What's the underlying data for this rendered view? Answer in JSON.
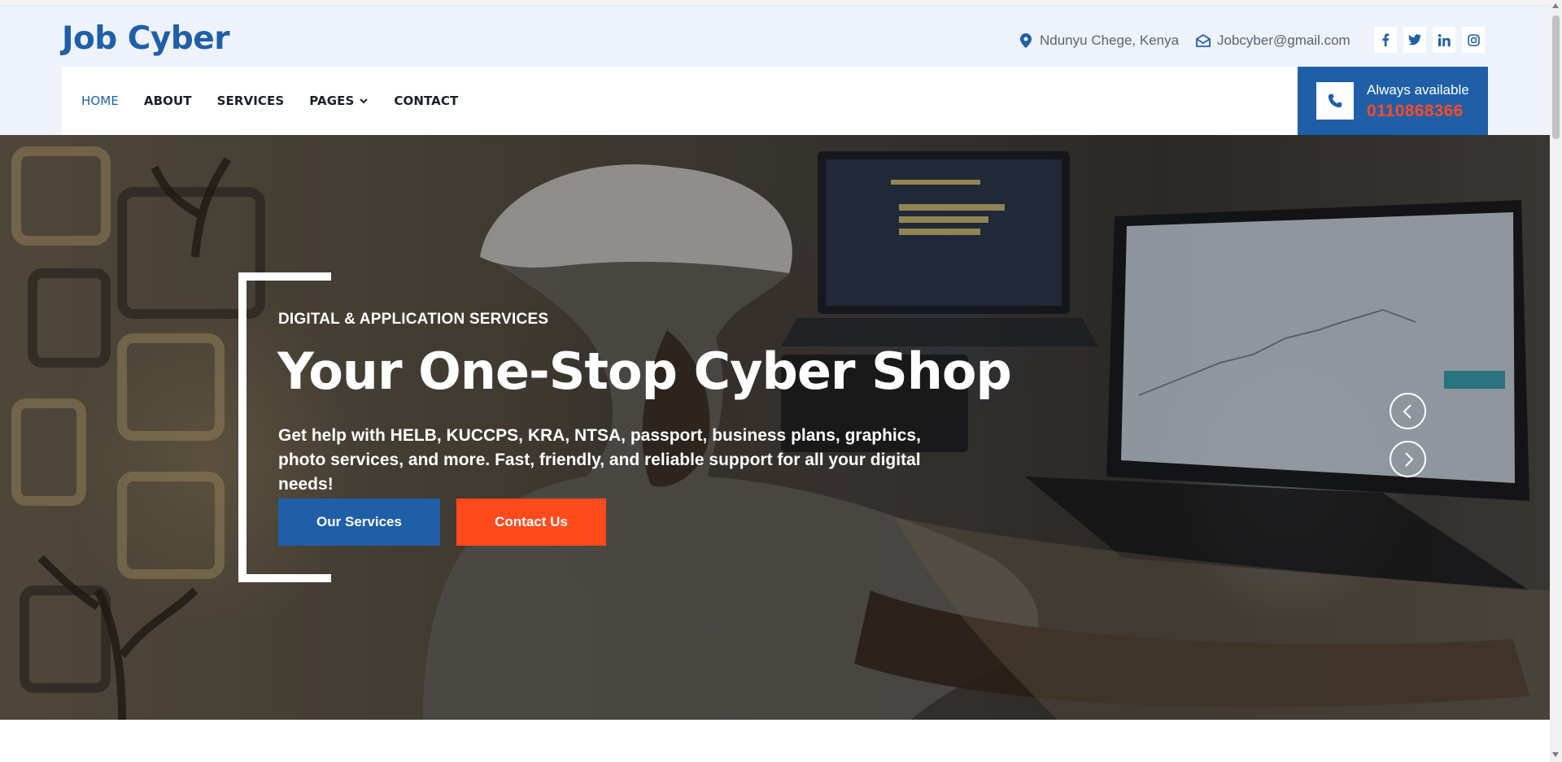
{
  "site": {
    "brand": "Job Cyber"
  },
  "topbar": {
    "location": "Ndunyu Chege, Kenya",
    "email": "Jobcyber@gmail.com",
    "socials": [
      {
        "name": "facebook",
        "glyph": "f"
      },
      {
        "name": "twitter",
        "glyph": "t"
      },
      {
        "name": "linkedin",
        "glyph": "in"
      },
      {
        "name": "instagram",
        "glyph": "ig"
      }
    ]
  },
  "nav": {
    "items": [
      "HOME",
      "ABOUT",
      "SERVICES",
      "PAGES",
      "CONTACT"
    ],
    "active": "HOME"
  },
  "callbox": {
    "label": "Always available",
    "number": "0110868366"
  },
  "hero": {
    "eyebrow": "DIGITAL & APPLICATION SERVICES",
    "title": "Your One-Stop Cyber Shop",
    "description": "Get help with HELB, KUCCPS, KRA, NTSA, passport, business plans, graphics, photo services, and more. Fast, friendly, and reliable support for all your digital needs!",
    "primary_button": "Our Services",
    "secondary_button": "Contact Us"
  },
  "colors": {
    "brand_blue": "#1f5fa8",
    "accent_orange": "#ff4a1c",
    "header_bg": "#eef3fb"
  }
}
